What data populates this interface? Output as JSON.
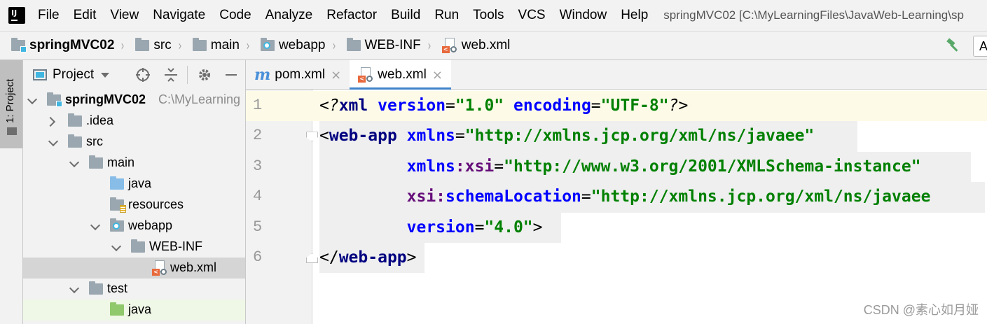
{
  "menu": {
    "items": [
      "File",
      "Edit",
      "View",
      "Navigate",
      "Code",
      "Analyze",
      "Refactor",
      "Build",
      "Run",
      "Tools",
      "VCS",
      "Window",
      "Help"
    ],
    "window_title": "springMVC02 [C:\\MyLearningFiles\\JavaWeb-Learning\\sp"
  },
  "breadcrumb": {
    "items": [
      {
        "label": "springMVC02",
        "icon": "module-folder-icon",
        "bold": true
      },
      {
        "label": "src",
        "icon": "folder-icon"
      },
      {
        "label": "main",
        "icon": "folder-icon"
      },
      {
        "label": "webapp",
        "icon": "web-folder-icon"
      },
      {
        "label": "WEB-INF",
        "icon": "folder-icon"
      },
      {
        "label": "web.xml",
        "icon": "xml-file-icon"
      }
    ],
    "run_config_label": "A"
  },
  "tool_strip": {
    "project_tab_label": "1: Project"
  },
  "project_panel": {
    "title": "Project",
    "tree": [
      {
        "label": "springMVC02",
        "path": "C:\\MyLearning",
        "arrow": "down",
        "icon": "module",
        "bold": true
      },
      {
        "label": ".idea",
        "arrow": "right",
        "icon": "folder"
      },
      {
        "label": "src",
        "arrow": "down",
        "icon": "folder"
      },
      {
        "label": "main",
        "arrow": "down",
        "icon": "folder"
      },
      {
        "label": "java",
        "arrow": "none",
        "icon": "source"
      },
      {
        "label": "resources",
        "arrow": "none",
        "icon": "resources"
      },
      {
        "label": "webapp",
        "arrow": "down",
        "icon": "web"
      },
      {
        "label": "WEB-INF",
        "arrow": "down",
        "icon": "folder"
      },
      {
        "label": "web.xml",
        "arrow": "none",
        "icon": "xml",
        "selected": true
      },
      {
        "label": "test",
        "arrow": "down",
        "icon": "folder"
      },
      {
        "label": "java",
        "arrow": "none",
        "icon": "test",
        "highlight": true
      }
    ]
  },
  "editor": {
    "tabs": [
      {
        "label": "pom.xml",
        "icon": "maven-icon",
        "active": false
      },
      {
        "label": "web.xml",
        "icon": "xml-file-icon",
        "active": true
      }
    ],
    "line_numbers": [
      "1",
      "2",
      "3",
      "4",
      "5",
      "6"
    ],
    "lines": [
      [
        [
          "pi",
          "<?"
        ],
        [
          "pi-name",
          "xml"
        ],
        [
          "punct",
          " "
        ],
        [
          "attr",
          "version"
        ],
        [
          "punct",
          "="
        ],
        [
          "val",
          "\"1.0\""
        ],
        [
          "punct",
          " "
        ],
        [
          "attr",
          "encoding"
        ],
        [
          "punct",
          "="
        ],
        [
          "val",
          "\"UTF-8\""
        ],
        [
          "pi",
          "?>"
        ]
      ],
      [
        [
          "punct",
          "<"
        ],
        [
          "tag",
          "web-app"
        ],
        [
          "punct",
          " "
        ],
        [
          "attr",
          "xmlns"
        ],
        [
          "punct",
          "="
        ],
        [
          "val",
          "\"http://xmlns.jcp.org/xml/ns/javaee\""
        ]
      ],
      [
        [
          "punct",
          "         "
        ],
        [
          "attr",
          "xmlns"
        ],
        [
          "ns",
          ":"
        ],
        [
          "ns",
          "xsi"
        ],
        [
          "punct",
          "="
        ],
        [
          "val",
          "\"http://www.w3.org/2001/XMLSchema-instance\""
        ]
      ],
      [
        [
          "punct",
          "         "
        ],
        [
          "ns",
          "xsi"
        ],
        [
          "ns",
          ":"
        ],
        [
          "attr",
          "schemaLocation"
        ],
        [
          "punct",
          "="
        ],
        [
          "val",
          "\"http://xmlns.jcp.org/xml/ns/javaee"
        ]
      ],
      [
        [
          "punct",
          "         "
        ],
        [
          "attr",
          "version"
        ],
        [
          "punct",
          "="
        ],
        [
          "val",
          "\"4.0\""
        ],
        [
          "punct",
          ">"
        ]
      ],
      [
        [
          "punct",
          "</"
        ],
        [
          "tag",
          "web-app"
        ],
        [
          "punct",
          ">"
        ]
      ]
    ]
  },
  "watermark": "CSDN @素心如月娅",
  "colors": {
    "accent": "#4083c9",
    "xml_tag": "#000080",
    "xml_attr": "#0000ff",
    "xml_value": "#008000",
    "xml_namespace": "#660e7a",
    "caret_line": "#fdfbe8"
  }
}
